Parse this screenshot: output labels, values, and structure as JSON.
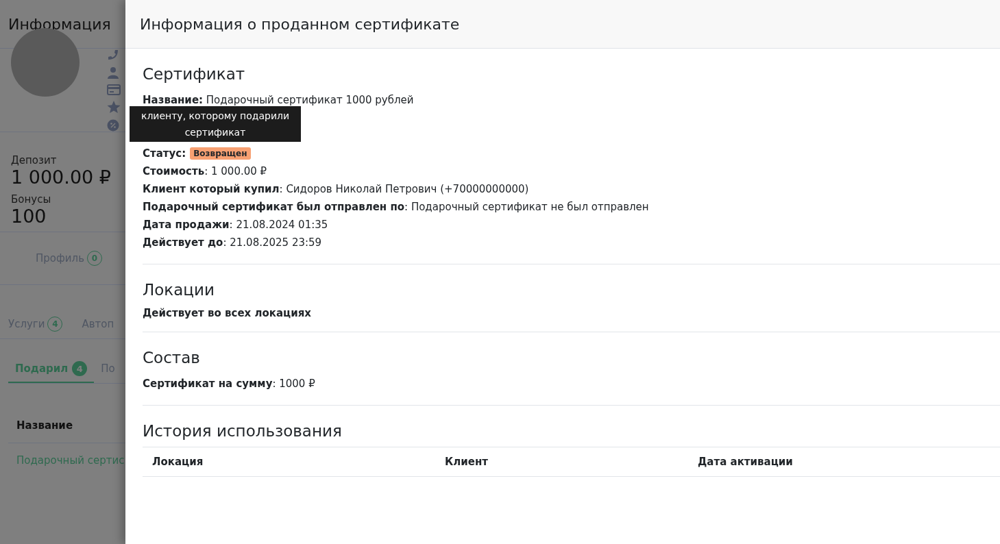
{
  "background": {
    "title": "Информация",
    "deposit": {
      "label": "Депозит",
      "value": "1 000.00 ₽"
    },
    "bonuses": {
      "label": "Бонусы",
      "value": "100"
    },
    "profile_tab": {
      "label": "Профиль",
      "count": "0"
    },
    "tabs": [
      {
        "label": "Услуги",
        "count": "4"
      },
      {
        "label": "Автоп"
      }
    ],
    "subtabs": [
      {
        "label": "Подарил",
        "count": "4",
        "selected": true
      },
      {
        "label": "По",
        "selected": false
      }
    ],
    "table": {
      "columns": [
        "Название"
      ],
      "rows": [
        "Подарочный сертис"
      ]
    }
  },
  "drawer": {
    "title": "Информация о проданном сертификате",
    "certificate": {
      "heading": "Сертификат",
      "fields": [
        {
          "value": "**Название:** Подарочный сертификат 1000 рублей",
          "kind": "text"
        },
        {
          "kind": "tooltip",
          "value": "клиенту, которому подарили сертификат"
        },
        {
          "label": "Статус:",
          "value": "Возвращен",
          "kind": "badge",
          "color": "#f7a072"
        },
        {
          "value": "**Стоимость**: 1 000.00 ₽",
          "kind": "text"
        },
        {
          "value": "**Клиент который купил**: Сидоров Николай Петрович (+70000000000)",
          "kind": "text"
        },
        {
          "value": "**Подарочный сертификат был отправлен по**: Подарочный сертификат не был отправлен",
          "kind": "text"
        },
        {
          "value": "**Дата продажи**: 21.08.2024 01:35",
          "kind": "text"
        },
        {
          "value": "**Действует до**: 21.08.2025 23:59",
          "kind": "text"
        }
      ]
    },
    "locations": {
      "heading": "Локации",
      "text": "Действует во всех локациях"
    },
    "contents": {
      "heading": "Состав",
      "text": "**Сертификат на сумму**: 1000 ₽"
    },
    "history": {
      "heading": "История использования",
      "columns": [
        "Локация",
        "Клиент",
        "Дата активации"
      ]
    }
  }
}
